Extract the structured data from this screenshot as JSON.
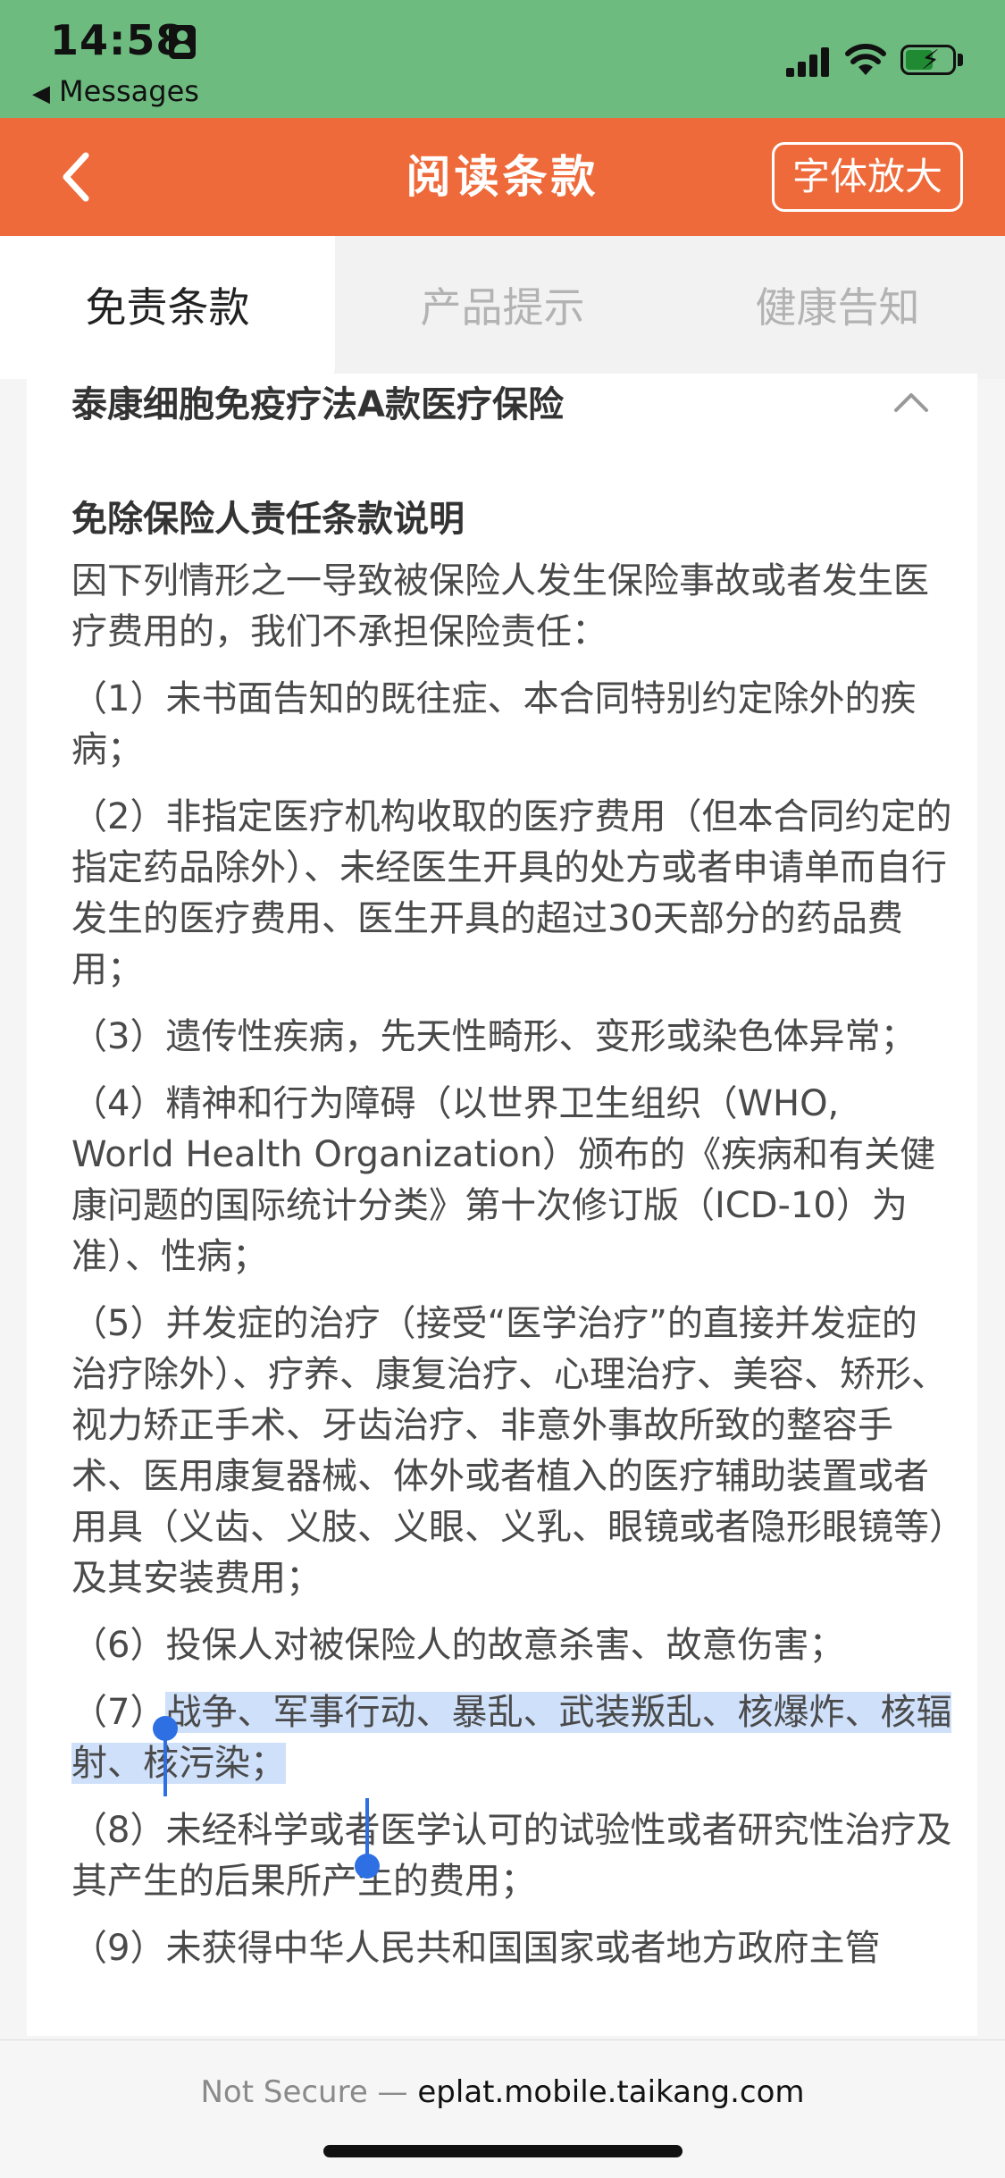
{
  "status_bar": {
    "time": "14:58",
    "back_app": "Messages",
    "icons": [
      "person-icon",
      "cellular-signal-icon",
      "wifi-icon",
      "battery-charging-icon"
    ]
  },
  "header": {
    "title": "阅读条款",
    "enlarge_font_button": "字体放大",
    "back_icon": "chevron-left-icon"
  },
  "tabs": [
    {
      "label": "免责条款",
      "active": true
    },
    {
      "label": "产品提示",
      "active": false
    },
    {
      "label": "健康告知",
      "active": false
    }
  ],
  "content": {
    "product_title": "泰康细胞免疫疗法A款医疗保险",
    "section_title": "免除保险人责任条款说明",
    "intro": "因下列情形之一导致被保险人发生保险事故或者发生医疗费用的，我们不承担保险责任：",
    "items": [
      "（1）未书面告知的既往症、本合同特别约定除外的疾病；",
      "（2）非指定医疗机构收取的医疗费用（但本合同约定的指定药品除外）、未经医生开具的处方或者申请单而自行发生的医疗费用、医生开具的超过30天部分的药品费用；",
      "（3）遗传性疾病，先天性畸形、变形或染色体异常；",
      "（4）精神和行为障碍（以世界卫生组织（WHO, World Health Organization）颁布的《疾病和有关健康问题的国际统计分类》第十次修订版（ICD-10）为准）、性病；",
      "（5）并发症的治疗（接受“医学治疗”的直接并发症的治疗除外）、疗养、康复治疗、心理治疗、美容、矫形、视力矫正手术、牙齿治疗、非意外事故所致的整容手术、医用康复器械、体外或者植入的医疗辅助装置或者用具（义齿、义肢、义眼、义乳、眼镜或者隐形眼镜等）及其安装费用；",
      "（6）投保人对被保险人的故意杀害、故意伤害；",
      "（8）未经科学或者医学认可的试验性或者研究性治疗及其产生的后果所产生的费用；",
      "（9）未获得中华人民共和国国家或者地方政府主管"
    ],
    "item7_prefix": "（7）",
    "item7_selected": "战争、军事行动、暴乱、武装叛乱、核爆炸、核辐射、核污染；"
  },
  "url_bar": {
    "not_secure": "Not Secure —",
    "domain": "eplat.mobile.taikang.com"
  }
}
